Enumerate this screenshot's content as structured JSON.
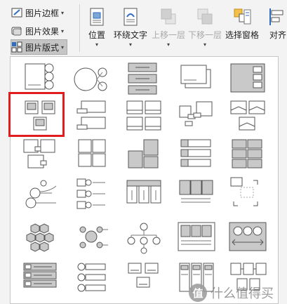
{
  "ribbon": {
    "left_menu": [
      {
        "label": "图片边框",
        "icon": "picture-border-icon"
      },
      {
        "label": "图片效果",
        "icon": "picture-effects-icon"
      },
      {
        "label": "图片版式",
        "icon": "picture-layout-icon"
      }
    ],
    "buttons": [
      {
        "label": "位置",
        "icon": "position-icon",
        "enabled": true
      },
      {
        "label": "环绕文字",
        "icon": "wrap-text-icon",
        "enabled": true
      },
      {
        "label": "上移一层",
        "icon": "bring-forward-icon",
        "enabled": false
      },
      {
        "label": "下移一层",
        "icon": "send-backward-icon",
        "enabled": false
      },
      {
        "label": "选择窗格",
        "icon": "selection-pane-icon",
        "enabled": true
      },
      {
        "label": "对齐",
        "icon": "align-icon",
        "enabled": true
      }
    ]
  },
  "gallery": {
    "selected_index": 5,
    "layout_icons": [
      "picture-layout-1-icon",
      "picture-layout-2-icon",
      "picture-layout-3-icon",
      "picture-layout-4-icon",
      "picture-layout-5-icon",
      "picture-layout-6-icon",
      "picture-layout-7-icon",
      "picture-layout-8-icon",
      "picture-layout-9-icon",
      "picture-layout-10-icon",
      "picture-layout-11-icon",
      "picture-layout-12-icon",
      "picture-layout-13-icon",
      "picture-layout-14-icon",
      "picture-layout-15-icon",
      "picture-layout-16-icon",
      "picture-layout-17-icon",
      "picture-layout-18-icon",
      "picture-layout-19-icon",
      "picture-layout-20-icon",
      "picture-layout-21-icon",
      "picture-layout-22-icon",
      "picture-layout-23-icon",
      "picture-layout-24-icon",
      "picture-layout-25-icon",
      "picture-layout-26-icon",
      "picture-layout-27-icon",
      "picture-layout-28-icon",
      "picture-layout-29-icon",
      "picture-layout-30-icon"
    ]
  },
  "watermark": {
    "text": "什么值得买",
    "logo": "值"
  },
  "colors": {
    "highlight": "#e01e1e",
    "icon_gray": "#c0c0c0",
    "icon_dark": "#555555"
  }
}
